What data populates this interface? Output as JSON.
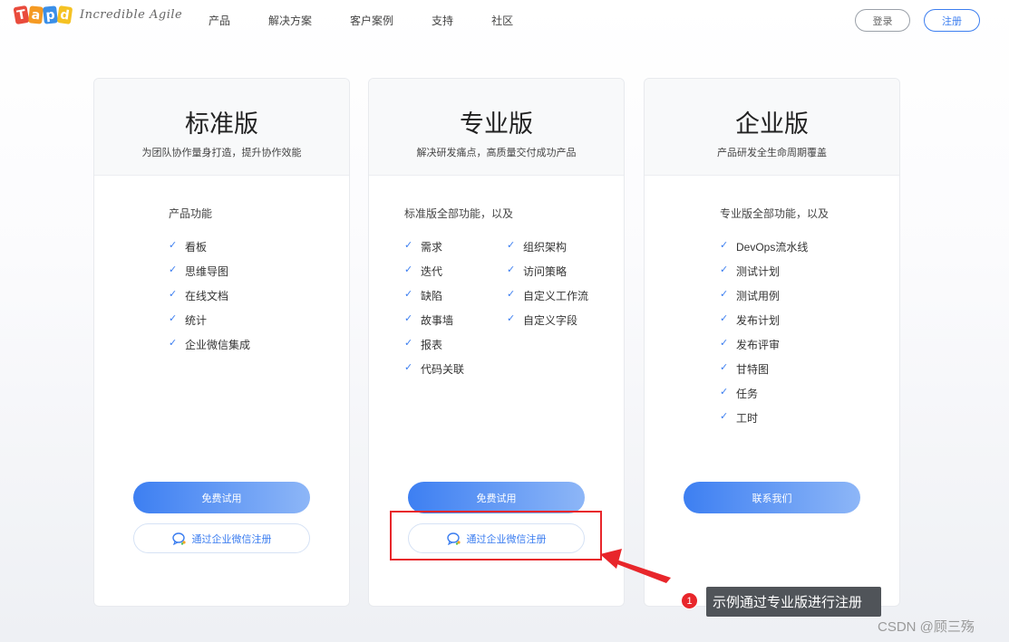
{
  "header": {
    "logo_letters": [
      "T",
      "a",
      "p",
      "d"
    ],
    "tagline": "Incredible Agile",
    "nav": [
      "产品",
      "解决方案",
      "客户案例",
      "支持",
      "社区"
    ],
    "login": "登录",
    "register": "注册"
  },
  "plans": [
    {
      "title": "标准版",
      "subtitle": "为团队协作量身打造，提升协作效能",
      "features_title": "产品功能",
      "features_col1": [
        "看板",
        "思维导图",
        "在线文档",
        "统计",
        "企业微信集成"
      ],
      "features_col2": [],
      "primary_button": "免费试用",
      "wecom_button": "通过企业微信注册"
    },
    {
      "title": "专业版",
      "subtitle": "解决研发痛点，高质量交付成功产品",
      "features_title": "标准版全部功能，以及",
      "features_col1": [
        "需求",
        "迭代",
        "缺陷",
        "故事墙",
        "报表",
        "代码关联"
      ],
      "features_col2": [
        "组织架构",
        "访问策略",
        "自定义工作流",
        "自定义字段"
      ],
      "primary_button": "免费试用",
      "wecom_button": "通过企业微信注册"
    },
    {
      "title": "企业版",
      "subtitle": "产品研发全生命周期覆盖",
      "features_title": "专业版全部功能，以及",
      "features_col1": [
        "DevOps流水线",
        "测试计划",
        "测试用例",
        "发布计划",
        "发布评审",
        "甘特图",
        "任务",
        "工时"
      ],
      "features_col2": [],
      "primary_button": "联系我们"
    }
  ],
  "annotation": {
    "number": "1",
    "text": "示例通过专业版进行注册",
    "color": "#e8262b"
  },
  "watermark": "CSDN @顾三殇",
  "colors": {
    "accent": "#3c7ef0",
    "gradient_end": "#8db6f7"
  }
}
